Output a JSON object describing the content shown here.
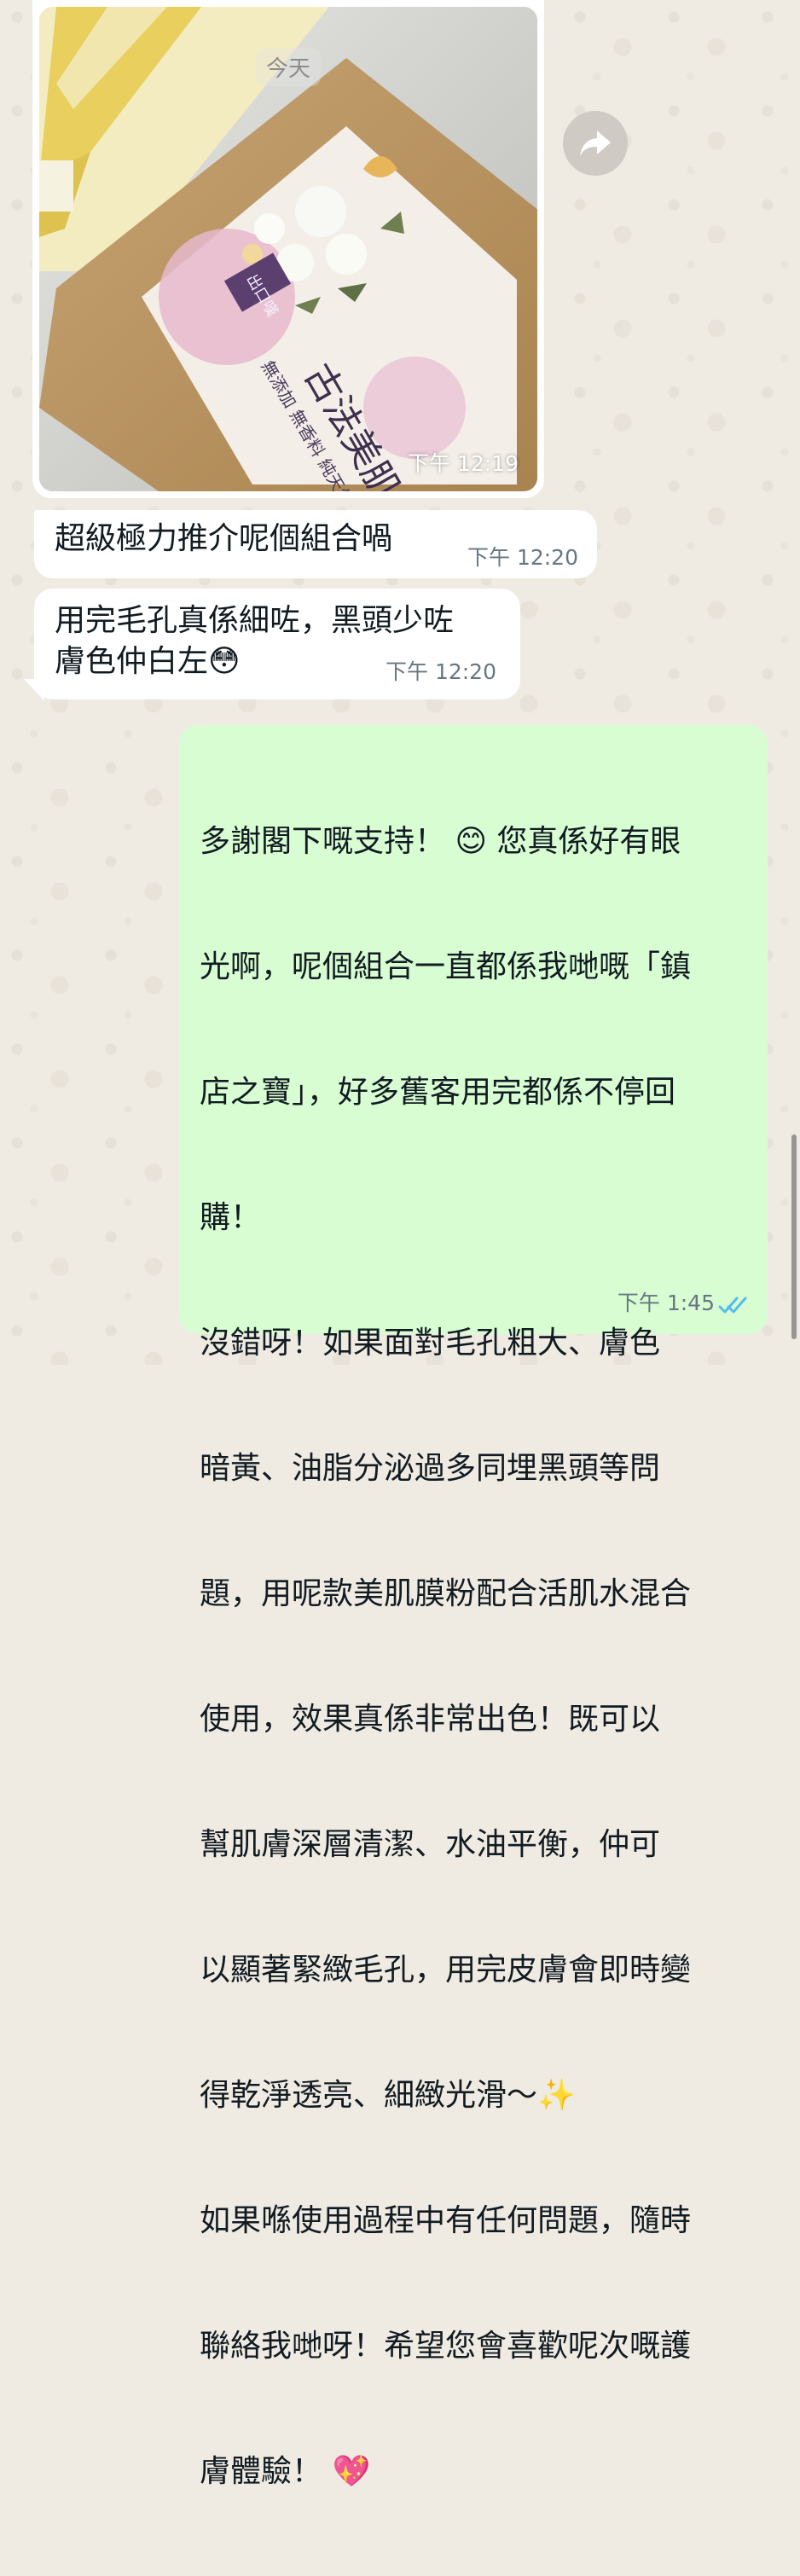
{
  "chat": {
    "date_label": "今天",
    "image_message": {
      "time": "下午 12:19",
      "product_name": "古法美肌膜粉",
      "brand": "出口嘆",
      "side_text_1": "無添加 無香料 純天然"
    },
    "incoming": [
      {
        "text": "超級極力推介呢個組合喎",
        "time": "下午 12:20"
      },
      {
        "text_line1": "用完毛孔真係細咗，黑頭少咗",
        "text_line2": "膚色仲白左",
        "emoji": "😳",
        "time": "下午 12:20"
      }
    ],
    "outgoing": {
      "lines": [
        "多謝閣下嘅支持！ 😊 您真係好有眼",
        "光啊，呢個組合一直都係我哋嘅「鎮",
        "店之寶」，好多舊客用完都係不停回",
        "購！",
        "沒錯呀！如果面對毛孔粗大、膚色",
        "暗黃、油脂分泌過多同埋黑頭等問",
        "題，用呢款美肌膜粉配合活肌水混合",
        "使用，效果真係非常出色！既可以",
        "幫肌膚深層清潔、水油平衡，仲可",
        "以顯著緊緻毛孔，用完皮膚會即時變",
        "得乾淨透亮、細緻光滑～✨",
        "如果喺使用過程中有任何問題，隨時",
        "聯絡我哋呀！希望您會喜歡呢次嘅護",
        "膚體驗！ 💖"
      ],
      "time": "下午 1:45",
      "status_icon": "double-check-read-icon"
    },
    "colors": {
      "background": "#efeae2",
      "incoming_bubble": "#ffffff",
      "outgoing_bubble": "#d9fdd3",
      "read_ticks": "#53bdeb",
      "time_text": "#667781"
    }
  }
}
